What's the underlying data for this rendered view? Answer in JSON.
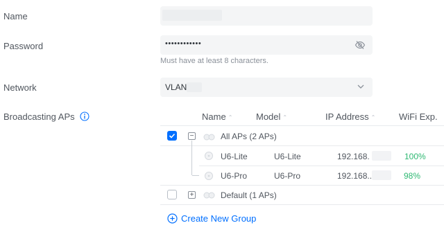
{
  "labels": {
    "name": "Name",
    "password": "Password",
    "network": "Network",
    "broadcasting": "Broadcasting APs"
  },
  "password": {
    "value": "••••••••••••",
    "hint": "Must have at least 8 characters."
  },
  "network": {
    "value": "VLAN"
  },
  "table": {
    "headers": [
      "Name",
      "Model",
      "IP Address",
      "WiFi Exp."
    ],
    "groups": [
      {
        "label": "All APs (2 APs)",
        "checked": true,
        "expanded": true
      },
      {
        "label": "Default (1 APs)",
        "checked": false,
        "expanded": false
      }
    ],
    "rows": [
      {
        "name": "U6-Lite",
        "model": "U6-Lite",
        "ip": "192.168.",
        "wifi_exp": "100%"
      },
      {
        "name": "U6-Pro",
        "model": "U6-Pro",
        "ip": "192.168..",
        "wifi_exp": "98%"
      }
    ]
  },
  "create_group": "Create New Group",
  "icons": {
    "info": "info-icon",
    "eye": "eye-slash-icon",
    "chevron": "chevron-down-icon",
    "plus_circle": "plus-circle-icon"
  },
  "colors": {
    "accent": "#006fff",
    "success": "#2eb872"
  }
}
